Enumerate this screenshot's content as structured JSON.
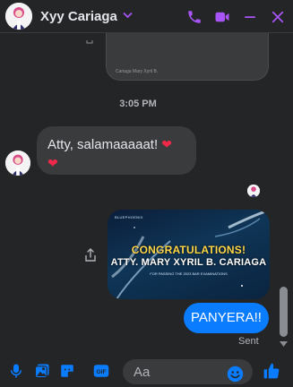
{
  "header": {
    "contact_name": "Xyy Cariaga"
  },
  "conversation": {
    "previous_image_caption": "Cariaga Mary Xyril B.",
    "timestamp": "3:05 PM",
    "incoming_message": "Atty, salamaaaaat!",
    "card": {
      "logo_text": "BLUEPHOENIX",
      "headline": "CONGRATULATIONS!",
      "name_line": "ATTY. MARY XYRIL B. CARIAGA",
      "subline": "FOR PASSING THE 2023 BAR EXAMINATIONS"
    },
    "outgoing_message": "PANYERA!!",
    "status": "Sent"
  },
  "composer": {
    "placeholder": "Aa"
  },
  "colors": {
    "accent": "#a855f7",
    "outgoing_bubble": "#0a7cff",
    "incoming_bubble": "#3a3b3c",
    "heart": "#f02849",
    "background": "#242526"
  }
}
